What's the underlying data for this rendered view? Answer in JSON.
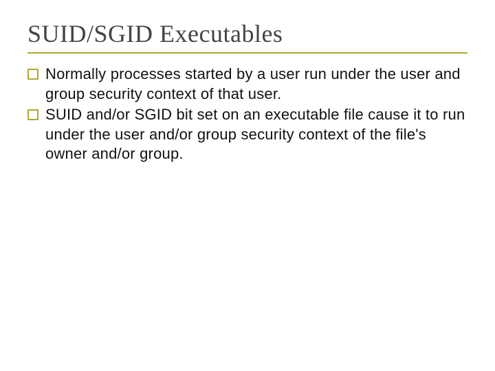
{
  "title": "SUID/SGID Executables",
  "bullets": [
    "Normally processes started by a user run under the user and group security context of that user.",
    "SUID and/or SGID bit set on an executable file cause it to run under the user and/or group security context of the file's owner and/or group."
  ]
}
